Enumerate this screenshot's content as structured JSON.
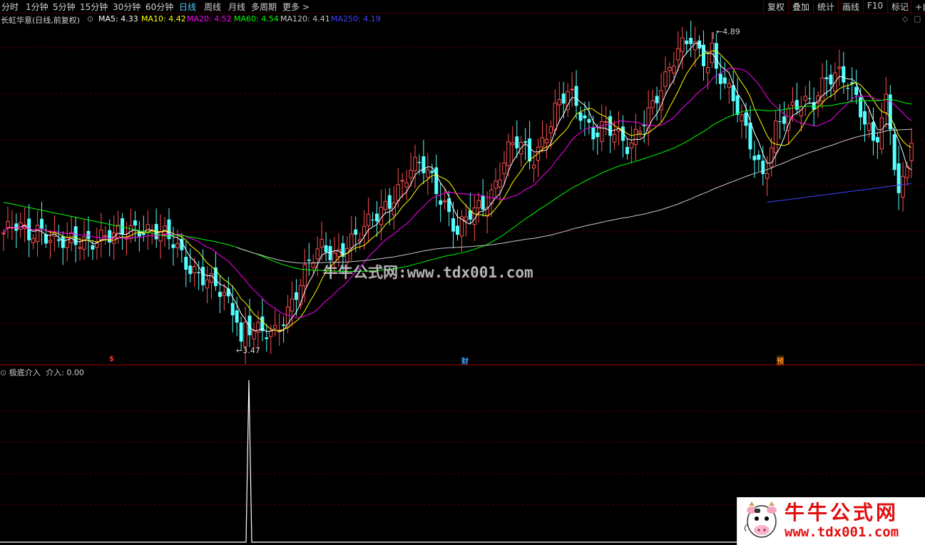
{
  "toolbar": {
    "periods": [
      "分时",
      "1分钟",
      "5分钟",
      "15分钟",
      "30分钟",
      "60分钟",
      "日线",
      "周线",
      "月线",
      "多周期",
      "更多 >"
    ],
    "active": "日线",
    "right_buttons": [
      "复权",
      "叠加",
      "统计",
      "画线",
      "F10",
      "标记",
      "+自"
    ]
  },
  "legend": {
    "title": "长虹华意(日线,前复权)",
    "ma5": "MA5: 4.33",
    "ma10": "MA10: 4.42",
    "ma20": "MA20: 4.52",
    "ma60": "MA60: 4.54",
    "ma120": "MA120: 4.41",
    "ma250": "MA250: 4.19",
    "colors": {
      "ma5": "#ffffff",
      "ma10": "#ffff00",
      "ma20": "#ff00ff",
      "ma60": "#00ff00",
      "ma120": "#c8c8c8",
      "ma250": "#4040ff"
    }
  },
  "price_labels": {
    "high": "4.89",
    "low": "3.47"
  },
  "markers": [
    {
      "text": "$",
      "color": "#ff3030"
    },
    {
      "text": "财",
      "color": "#40a0ff"
    },
    {
      "text": "预",
      "color": "#ff9020"
    }
  ],
  "sub_panel": {
    "title": "极底介入",
    "value": "介入: 0.00"
  },
  "watermark": {
    "center": "牛牛公式网:www.tdx001.com",
    "logo_title": "牛牛公式网",
    "logo_url": "www.tdx001.com"
  },
  "chart_data": {
    "type": "candlestick",
    "title": "长虹华意(日线,前复权)",
    "y_marks": {
      "high": 4.89,
      "low": 3.47
    },
    "candles_approx_close": [
      3.98,
      4.0,
      3.97,
      4.02,
      3.95,
      3.92,
      3.94,
      3.96,
      3.97,
      3.95,
      3.98,
      4.02,
      4.0,
      3.96,
      3.92,
      3.85,
      3.8,
      3.74,
      3.68,
      3.62,
      3.57,
      3.52,
      3.5,
      3.62,
      3.75,
      3.85,
      3.9,
      3.88,
      3.95,
      3.97,
      4.02,
      4.1,
      4.18,
      4.25,
      4.28,
      4.22,
      4.12,
      3.98,
      4.05,
      4.1,
      4.2,
      4.35,
      4.38,
      4.3,
      4.42,
      4.55,
      4.6,
      4.52,
      4.45,
      4.48,
      4.4,
      4.35,
      4.5,
      4.58,
      4.66,
      4.8,
      4.89,
      4.78,
      4.7,
      4.62,
      4.55,
      4.38,
      4.2,
      4.45,
      4.55,
      4.6,
      4.55,
      4.65,
      4.72,
      4.68,
      4.5,
      4.35,
      4.6,
      4.15,
      4.4
    ],
    "indicator": {
      "name": "介入",
      "spike_index": 23,
      "spike_value": 1.0
    }
  }
}
